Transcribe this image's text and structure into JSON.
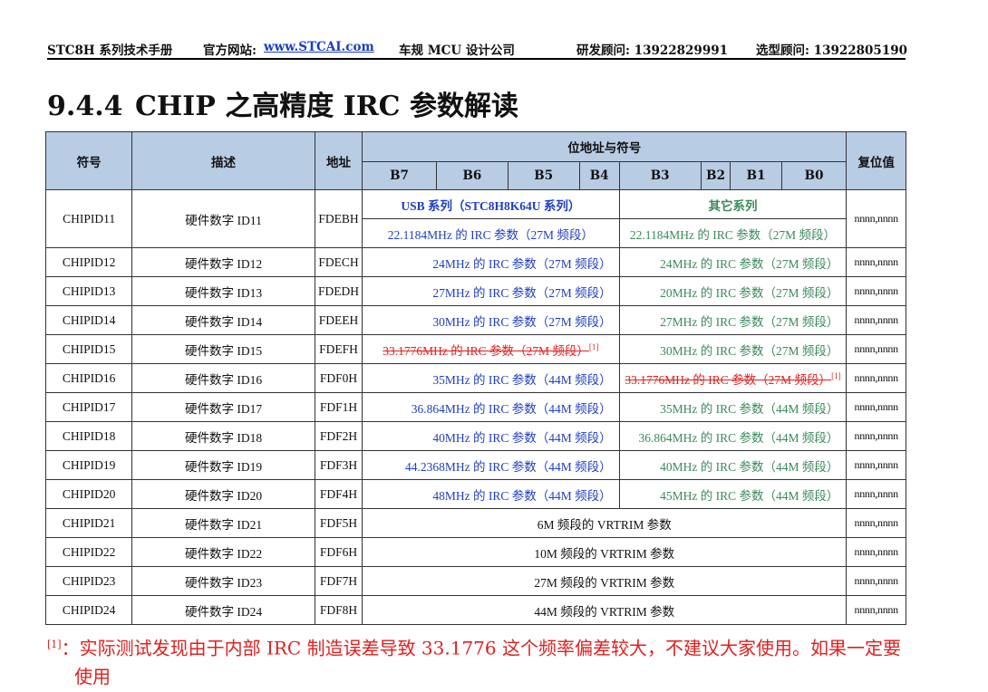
{
  "header": {
    "manual": "STC8H 系列技术手册",
    "site_label": "官方网站:",
    "site_link": "www.STCAI.com",
    "company": "车规 MCU 设计公司",
    "rd_consultant": "研发顾问: 13922829991",
    "selection_consultant": "选型顾问: 13922805190"
  },
  "section": {
    "number": "9.4.4",
    "title": "CHIP 之高精度 IRC 参数解读"
  },
  "table": {
    "headers": {
      "symbol": "符号",
      "desc": "描述",
      "addr": "地址",
      "bits": "位地址与符号",
      "reset": "复位值",
      "bit_names": [
        "B7",
        "B6",
        "B5",
        "B4",
        "B3",
        "B2",
        "B1",
        "B0"
      ]
    },
    "group_left": "USB 系列（STC8H8K64U 系列）",
    "group_right": "其它系列",
    "rows": [
      {
        "symbol": "CHIPID11",
        "desc": "硬件数字 ID11",
        "addr": "FDEBH",
        "left": "22.1184MHz 的 IRC 参数（27M 频段）",
        "right": "22.1184MHz 的 IRC 参数（27M 频段）",
        "reset": "nnnn,nnnn"
      },
      {
        "symbol": "CHIPID12",
        "desc": "硬件数字 ID12",
        "addr": "FDECH",
        "left": "24MHz 的 IRC 参数（27M 频段）",
        "right": "24MHz 的 IRC 参数（27M 频段）",
        "reset": "nnnn,nnnn"
      },
      {
        "symbol": "CHIPID13",
        "desc": "硬件数字 ID13",
        "addr": "FDEDH",
        "left": "27MHz 的 IRC 参数（27M 频段）",
        "right": "20MHz 的 IRC 参数（27M 频段）",
        "reset": "nnnn,nnnn"
      },
      {
        "symbol": "CHIPID14",
        "desc": "硬件数字 ID14",
        "addr": "FDEEH",
        "left": "30MHz 的 IRC 参数（27M 频段）",
        "right": "27MHz 的 IRC 参数（27M 频段）",
        "reset": "nnnn,nnnn"
      },
      {
        "symbol": "CHIPID15",
        "desc": "硬件数字 ID15",
        "addr": "FDEFH",
        "left": "33.1776MHz 的 IRC 参数（27M 频段）",
        "right": "30MHz 的 IRC 参数（27M 频段）",
        "reset": "nnnn,nnnn"
      },
      {
        "symbol": "CHIPID16",
        "desc": "硬件数字 ID16",
        "addr": "FDF0H",
        "left": "35MHz 的 IRC 参数（44M 频段）",
        "right": "33.1776MHz 的 IRC 参数（27M 频段）",
        "reset": "nnnn,nnnn"
      },
      {
        "symbol": "CHIPID17",
        "desc": "硬件数字 ID17",
        "addr": "FDF1H",
        "left": "36.864MHz 的 IRC 参数（44M 频段）",
        "right": "35MHz 的 IRC 参数（44M 频段）",
        "reset": "nnnn,nnnn"
      },
      {
        "symbol": "CHIPID18",
        "desc": "硬件数字 ID18",
        "addr": "FDF2H",
        "left": "40MHz 的 IRC 参数（44M 频段）",
        "right": "36.864MHz 的 IRC 参数（44M 频段）",
        "reset": "nnnn,nnnn"
      },
      {
        "symbol": "CHIPID19",
        "desc": "硬件数字 ID19",
        "addr": "FDF3H",
        "left": "44.2368MHz 的 IRC 参数（44M 频段）",
        "right": "40MHz 的 IRC 参数（44M 频段）",
        "reset": "nnnn,nnnn"
      },
      {
        "symbol": "CHIPID20",
        "desc": "硬件数字 ID20",
        "addr": "FDF4H",
        "left": "48MHz 的 IRC 参数（44M 频段）",
        "right": "45MHz 的 IRC 参数（44M 频段）",
        "reset": "nnnn,nnnn"
      },
      {
        "symbol": "CHIPID21",
        "desc": "硬件数字 ID21",
        "addr": "FDF5H",
        "span": "6M 频段的 VRTRIM 参数",
        "reset": "nnnn,nnnn"
      },
      {
        "symbol": "CHIPID22",
        "desc": "硬件数字 ID22",
        "addr": "FDF6H",
        "span": "10M 频段的 VRTRIM 参数",
        "reset": "nnnn,nnnn"
      },
      {
        "symbol": "CHIPID23",
        "desc": "硬件数字 ID23",
        "addr": "FDF7H",
        "span": "27M 频段的 VRTRIM 参数",
        "reset": "nnnn,nnnn"
      },
      {
        "symbol": "CHIPID24",
        "desc": "硬件数字 ID24",
        "addr": "FDF8H",
        "span": "44M 频段的 VRTRIM 参数",
        "reset": "nnnn,nnnn"
      }
    ],
    "footnote_mark": "[1]"
  },
  "footnote": {
    "mark": "[1]",
    "line1": "：实际测试发现由于内部 IRC 制造误差导致 33.1776 这个频率偏差较大，不建议大家使用。如果一定要",
    "line2": "使用"
  },
  "colors": {
    "header_bg": "#b8cce4",
    "usb_text": "#1f3fbf",
    "other_text": "#3a8a5a",
    "warning": "#e02020"
  }
}
